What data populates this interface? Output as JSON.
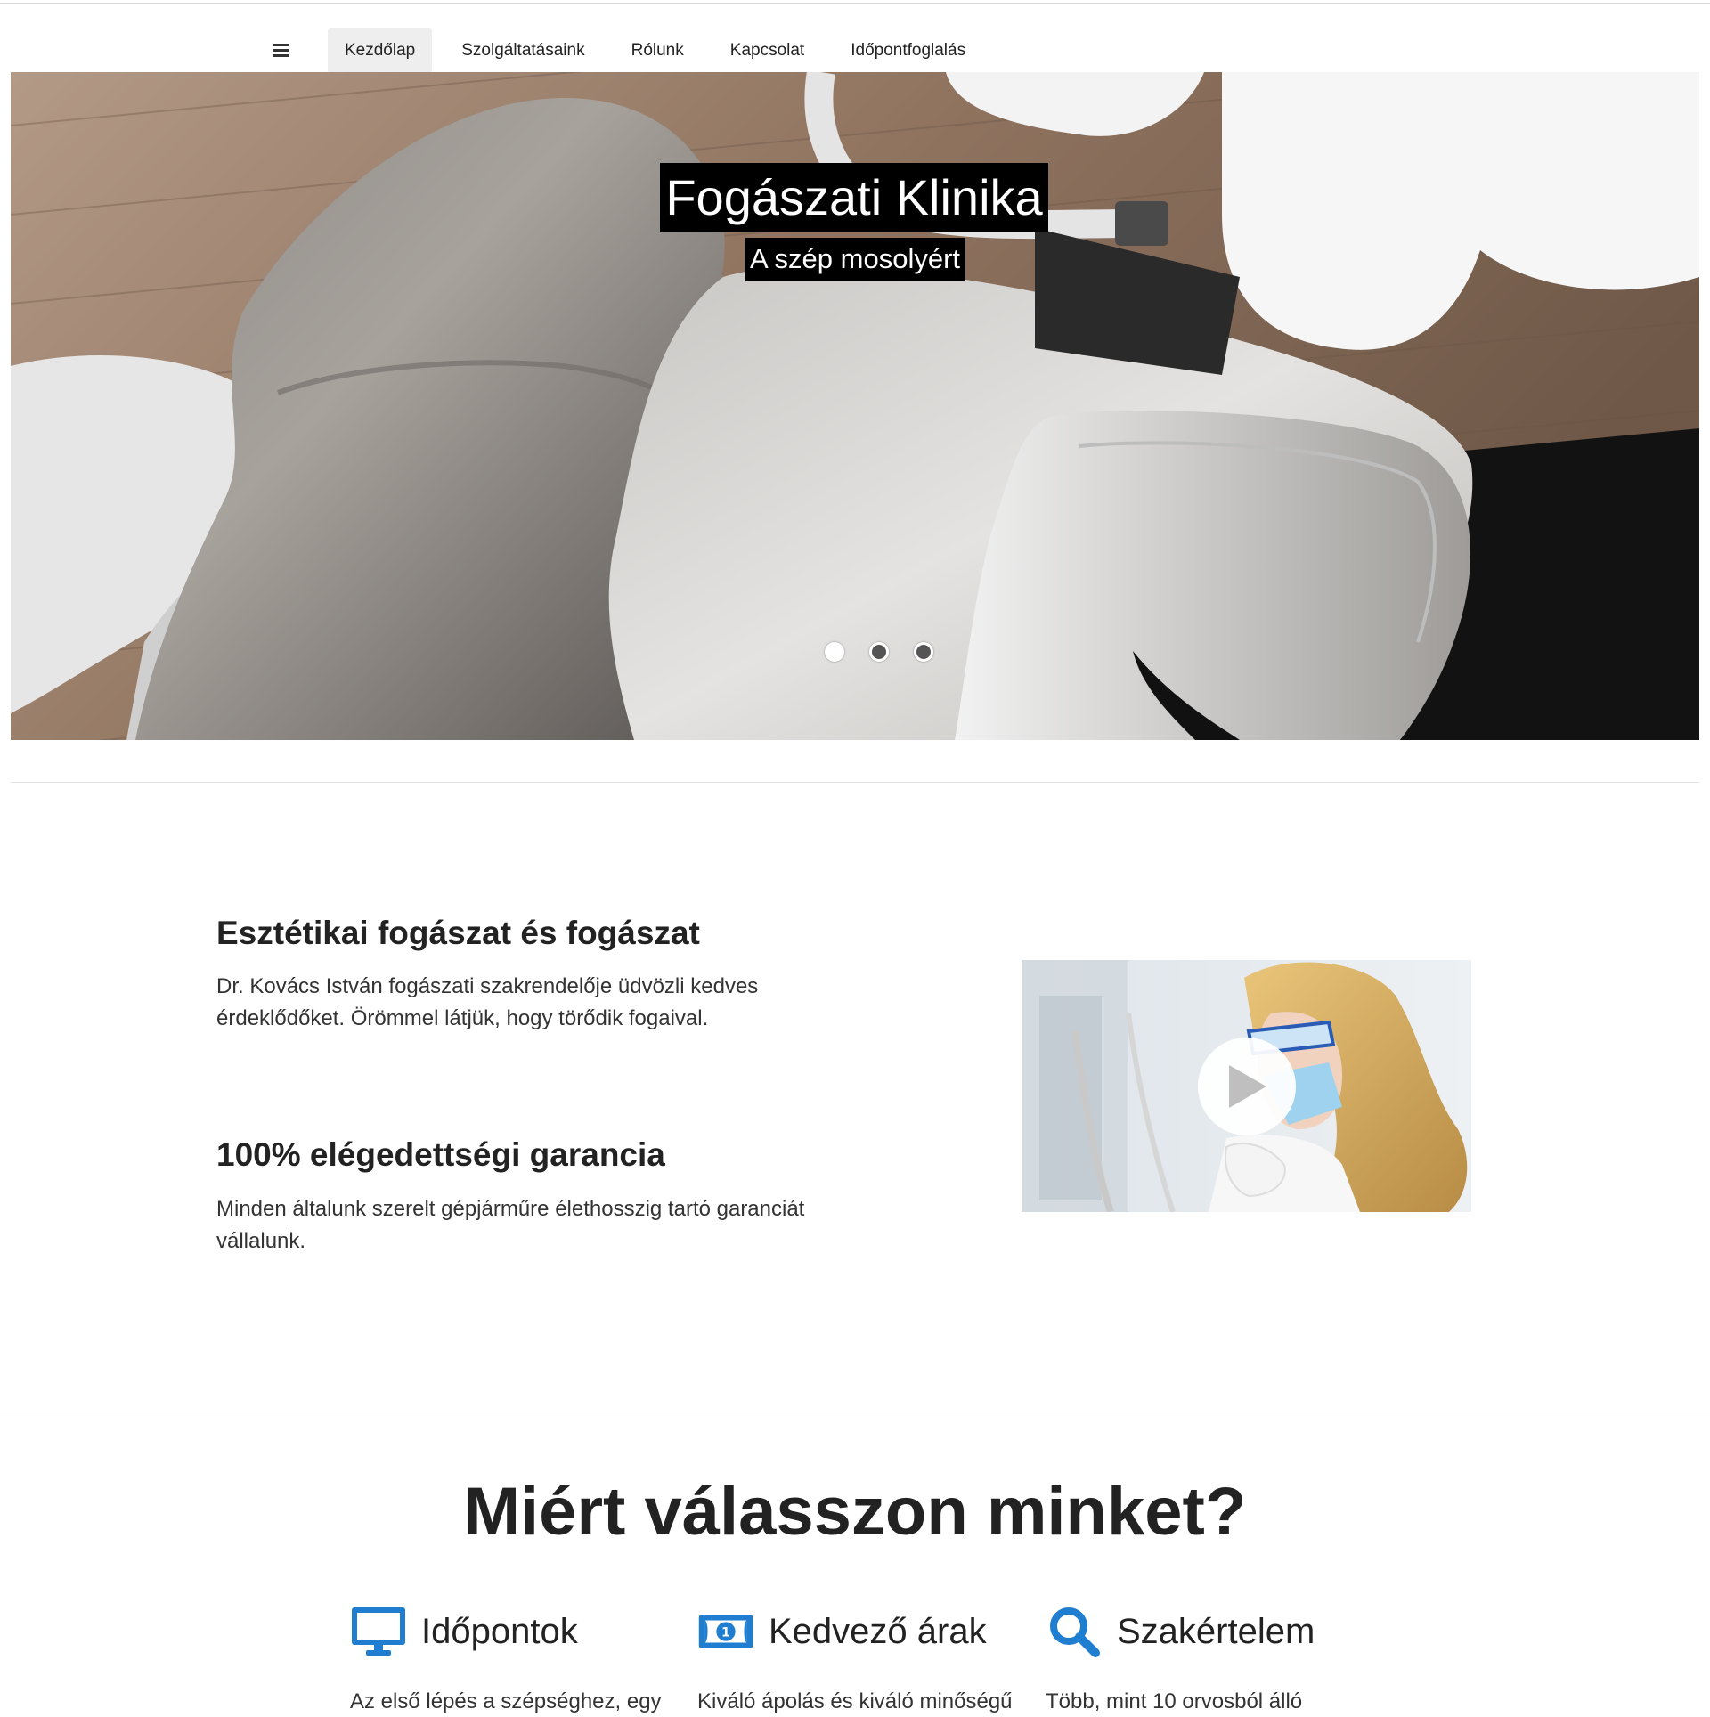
{
  "nav": {
    "menu_icon": "hamburger-menu-icon",
    "items": [
      {
        "label": "Kezdőlap",
        "active": true
      },
      {
        "label": "Szolgáltatásaink",
        "active": false
      },
      {
        "label": "Rólunk",
        "active": false
      },
      {
        "label": "Kapcsolat",
        "active": false
      },
      {
        "label": "Időpontfoglalás",
        "active": false
      }
    ]
  },
  "hero": {
    "title": "Fogászati Klinika",
    "subtitle": "A szép mosolyért",
    "slide_count": 3,
    "active_slide": 1
  },
  "intro": {
    "blocks": [
      {
        "heading": "Esztétikai fogászat és fogászat",
        "text": "Dr. Kovács István fogászati szakrendelője üdvözli kedves érdeklődőket. Örömmel látjük, hogy törődik fogaival."
      },
      {
        "heading": "100% elégedettségi garancia",
        "text": "Minden általunk szerelt gépjárműre élethosszig tartó garanciát vállalunk."
      }
    ],
    "video_icon": "play-icon"
  },
  "why": {
    "title": "Miért válasszon minket?",
    "features": [
      {
        "icon": "monitor-icon",
        "title": "Időpontok",
        "text": "Az első lépés a szépséghez, egy"
      },
      {
        "icon": "money-icon",
        "title": "Kedvező árak",
        "text": "Kiváló ápolás és kiváló minőségű"
      },
      {
        "icon": "search-icon",
        "title": "Szakértelem",
        "text": "Több, mint 10 orvosból álló"
      }
    ]
  },
  "colors": {
    "accent_blue": "#1f7ed0",
    "nav_active_bg": "#eeeeee",
    "text": "#222222"
  }
}
